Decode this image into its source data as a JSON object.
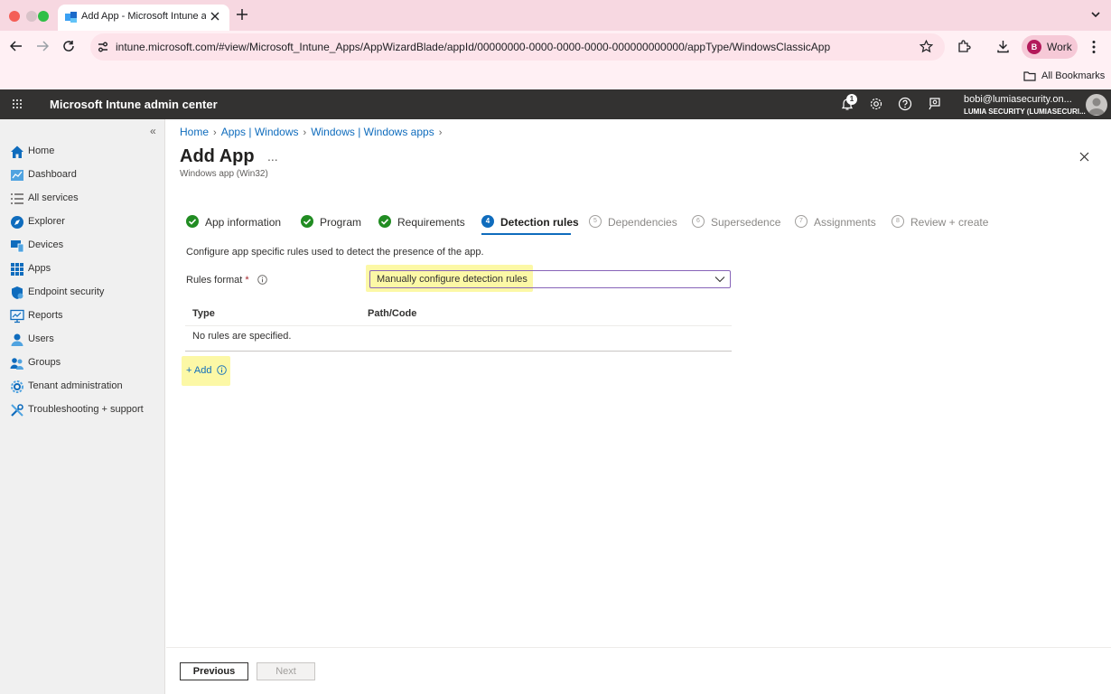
{
  "browser": {
    "tab_title": "Add App - Microsoft Intune a",
    "url": "intune.microsoft.com/#view/Microsoft_Intune_Apps/AppWizardBlade/appId/00000000-0000-0000-0000-000000000000/appType/WindowsClassicApp",
    "profile_initial": "B",
    "profile_label": "Work",
    "bookmarks_label": "All Bookmarks"
  },
  "header": {
    "app_title": "Microsoft Intune admin center",
    "notification_count": "1",
    "account_email": "bobi@lumiasecurity.on...",
    "account_tenant": "LUMIA SECURITY (LUMIASECURI..."
  },
  "sidebar": {
    "collapse_glyph": "«",
    "items": [
      {
        "label": "Home",
        "icon": "home-icon"
      },
      {
        "label": "Dashboard",
        "icon": "dashboard-icon"
      },
      {
        "label": "All services",
        "icon": "list-icon"
      },
      {
        "label": "Explorer",
        "icon": "explorer-icon"
      },
      {
        "label": "Devices",
        "icon": "devices-icon"
      },
      {
        "label": "Apps",
        "icon": "apps-icon"
      },
      {
        "label": "Endpoint security",
        "icon": "shield-icon"
      },
      {
        "label": "Reports",
        "icon": "reports-icon"
      },
      {
        "label": "Users",
        "icon": "user-icon"
      },
      {
        "label": "Groups",
        "icon": "groups-icon"
      },
      {
        "label": "Tenant administration",
        "icon": "tenant-icon"
      },
      {
        "label": "Troubleshooting + support",
        "icon": "tools-icon"
      }
    ]
  },
  "breadcrumbs": [
    "Home",
    "Apps | Windows",
    "Windows | Windows apps"
  ],
  "page": {
    "title": "Add App",
    "more": "...",
    "subtitle": "Windows app (Win32)"
  },
  "steps": [
    {
      "num": "1",
      "label": "App information",
      "state": "done"
    },
    {
      "num": "2",
      "label": "Program",
      "state": "done"
    },
    {
      "num": "3",
      "label": "Requirements",
      "state": "done"
    },
    {
      "num": "4",
      "label": "Detection rules",
      "state": "active"
    },
    {
      "num": "5",
      "label": "Dependencies",
      "state": "pending"
    },
    {
      "num": "6",
      "label": "Supersedence",
      "state": "pending"
    },
    {
      "num": "7",
      "label": "Assignments",
      "state": "pending"
    },
    {
      "num": "8",
      "label": "Review + create",
      "state": "pending"
    }
  ],
  "detection": {
    "description": "Configure app specific rules used to detect the presence of the app.",
    "rules_format_label": "Rules format",
    "required_mark": "*",
    "rules_format_value": "Manually configure detection rules",
    "columns": [
      "Type",
      "Path/Code"
    ],
    "empty_text": "No rules are specified.",
    "add_label": "+ Add"
  },
  "footer": {
    "previous_label": "Previous",
    "next_label": "Next"
  },
  "colors": {
    "accent": "#0f6cbd",
    "success": "#218c22",
    "highlight": "#fcf8a6",
    "header_bg": "#333231"
  }
}
